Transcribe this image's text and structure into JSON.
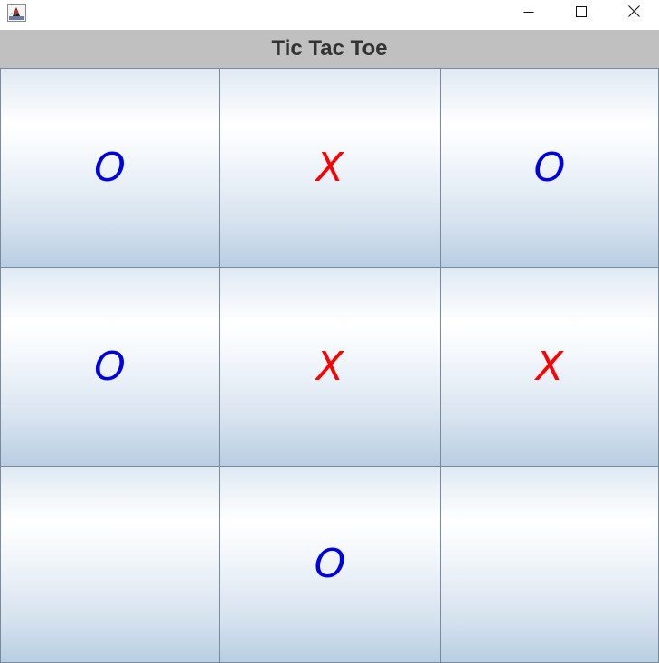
{
  "window": {
    "title": "",
    "app_icon": "java-duke-icon",
    "controls": {
      "minimize_icon": "minimize-icon",
      "maximize_icon": "maximize-icon",
      "close_icon": "close-icon"
    }
  },
  "header": {
    "title": "Tic Tac Toe",
    "background": "#c0c0c0",
    "color": "#333333"
  },
  "board": {
    "rows": 3,
    "cols": 3,
    "o_color": "#0000e0",
    "x_color": "#ff0000",
    "cells": [
      "O",
      "X",
      "O",
      "O",
      "X",
      "X",
      "",
      "O",
      ""
    ]
  }
}
